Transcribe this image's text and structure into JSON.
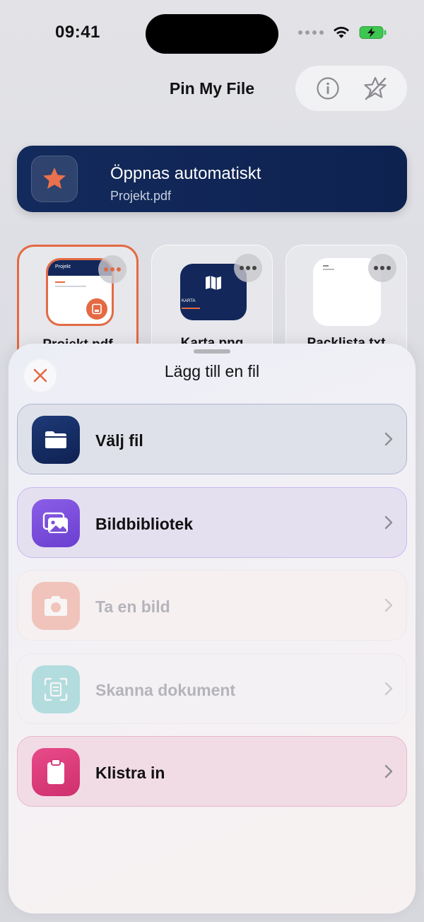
{
  "status": {
    "time": "09:41"
  },
  "app": {
    "title": "Pin My File"
  },
  "banner": {
    "title": "Öppnas automatiskt",
    "subtitle": "Projekt.pdf",
    "icon": "star-icon"
  },
  "files": [
    {
      "name": "Projekt.pdf",
      "selected": true,
      "thumb_title": "Projekt"
    },
    {
      "name": "Karta.png",
      "selected": false,
      "thumb_title": "KARTA"
    },
    {
      "name": "Packlista.txt",
      "selected": false
    }
  ],
  "sheet": {
    "title": "Lägg till en fil",
    "options": [
      {
        "label": "Välj fil",
        "icon": "folder-icon",
        "enabled": true,
        "color": "#13275a"
      },
      {
        "label": "Bildbibliotek",
        "icon": "photos-icon",
        "enabled": true,
        "color": "#7a4fd6"
      },
      {
        "label": "Ta en bild",
        "icon": "camera-icon",
        "enabled": false,
        "color": "#e8735a"
      },
      {
        "label": "Skanna dokument",
        "icon": "scan-document-icon",
        "enabled": false,
        "color": "#3bb7b3"
      },
      {
        "label": "Klistra in",
        "icon": "clipboard-icon",
        "enabled": true,
        "color": "#d83a7c"
      }
    ]
  },
  "colors": {
    "accent": "#e36a43",
    "navy": "#132a5c"
  }
}
